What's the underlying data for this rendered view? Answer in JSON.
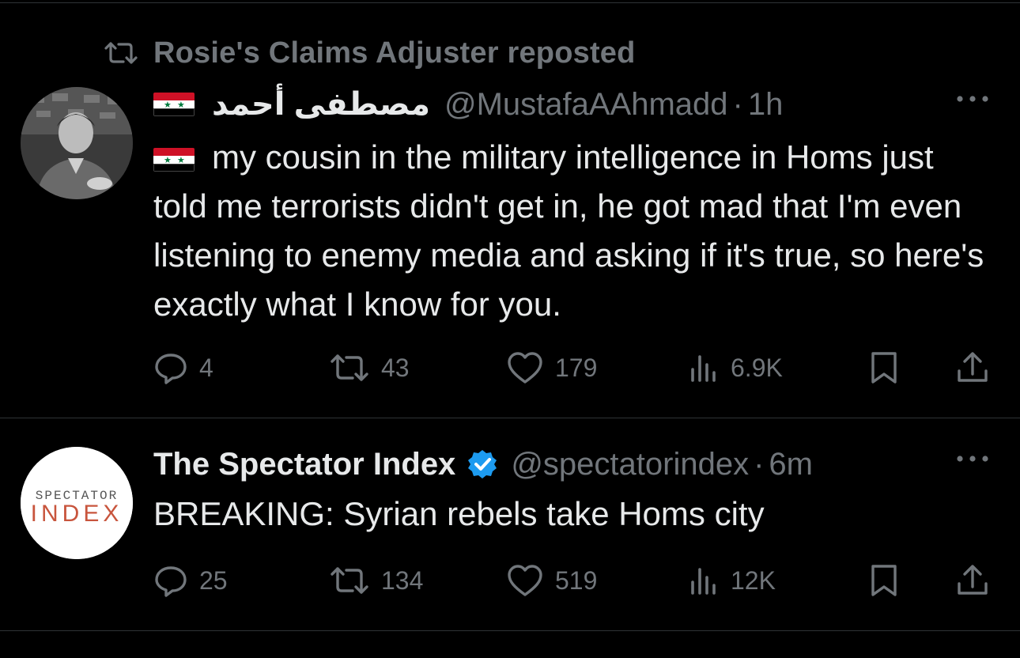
{
  "timeline": {
    "tweets": [
      {
        "repost_header": "Rosie's Claims Adjuster reposted",
        "author": {
          "display_name": "مصطفى أحمد",
          "handle": "@MustafaAAhmadd",
          "name_prefix_icon": "syria-flag-icon"
        },
        "time": "1h",
        "separator": "·",
        "text": "my cousin in the military intelligence in Homs just told me terrorists didn't get in, he got mad that I'm even listening to enemy media and asking if it's true, so here's exactly what I know for you.",
        "text_prefix_icon": "syria-flag-icon",
        "stats": {
          "replies": "4",
          "reposts": "43",
          "likes": "179",
          "views": "6.9K"
        }
      },
      {
        "author": {
          "display_name": "The Spectator Index",
          "handle": "@spectatorindex",
          "verified": true,
          "avatar_line1": "SPECTATOR",
          "avatar_line2": "INDEX"
        },
        "time": "6m",
        "separator": "·",
        "text": "BREAKING: Syrian rebels take Homs city",
        "stats": {
          "replies": "25",
          "reposts": "134",
          "likes": "519",
          "views": "12K"
        }
      }
    ]
  },
  "colors": {
    "background": "#000000",
    "text_primary": "#e7e9ea",
    "text_secondary": "#71767b",
    "divider": "#2f3336",
    "verified": "#1d9bf0",
    "spectator_red": "#c8553d"
  },
  "icons": [
    "repost-icon",
    "more-icon",
    "reply-icon",
    "like-icon",
    "views-icon",
    "bookmark-icon",
    "share-icon",
    "verified-badge-icon",
    "syria-flag-icon"
  ]
}
